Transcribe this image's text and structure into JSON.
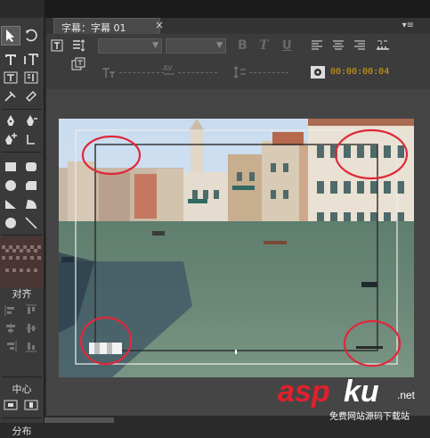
{
  "tab": {
    "title": "字幕：字幕 01",
    "close_glyph": "×",
    "menu_glyph": "▾≡"
  },
  "toolbar": {
    "bold": "B",
    "italic": "T",
    "underline": "U",
    "timecode": "00:00:00:04"
  },
  "tools": {
    "align_label": "对齐",
    "center_label": "中心",
    "distribute_label": "分布"
  },
  "watermark": {
    "brand_red": "asp",
    "brand_white": "ku",
    "brand_suffix": ".net",
    "tagline": "免费网站源码下载站"
  },
  "colors": {
    "timecode": "#e0a200",
    "annotation_circle": "#e0283a",
    "panel_bg": "#3c3c3c"
  }
}
